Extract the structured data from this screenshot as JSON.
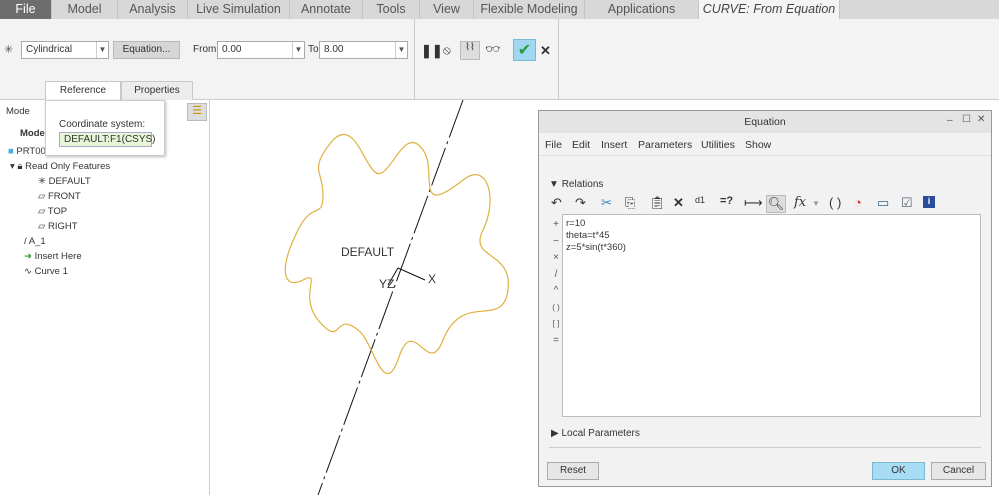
{
  "tabs": [
    "File",
    "Model",
    "Analysis",
    "Live Simulation",
    "Annotate",
    "Tools",
    "View",
    "Flexible Modeling",
    "Applications",
    "CURVE: From Equation"
  ],
  "ribbon": {
    "coord_type": "Cylindrical",
    "equation_button": "Equation...",
    "from_label": "From",
    "from_value": "0.00",
    "to_label": "To",
    "to_value": "8.00",
    "tabs": [
      "Reference",
      "Properties"
    ]
  },
  "popup": {
    "label": "Coordinate system:",
    "value": "DEFAULT:F1(CSYS)"
  },
  "tree": {
    "header": "Mode",
    "header2": "Model",
    "root": "PRT00",
    "items": [
      "Read Only Features",
      "DEFAULT",
      "FRONT",
      "TOP",
      "RIGHT",
      "A_1",
      "Insert Here",
      "Curve 1"
    ]
  },
  "canvas": {
    "csys_label": "DEFAULT",
    "axis_x": "X",
    "axis_yz": "YZ",
    "curve_color": "#e0b040"
  },
  "dialog": {
    "title": "Equation",
    "menu": [
      "File",
      "Edit",
      "Insert",
      "Parameters",
      "Utilities",
      "Show"
    ],
    "relations_label": "Relations",
    "lines": [
      "r=10",
      "theta=t*45",
      "z=5*sin(t*360)"
    ],
    "side_ops": [
      "+",
      "−",
      "×",
      "/",
      "^",
      "( )",
      "[ ]",
      "="
    ],
    "local_params": "Local Parameters",
    "reset": "Reset",
    "ok": "OK",
    "cancel": "Cancel"
  }
}
